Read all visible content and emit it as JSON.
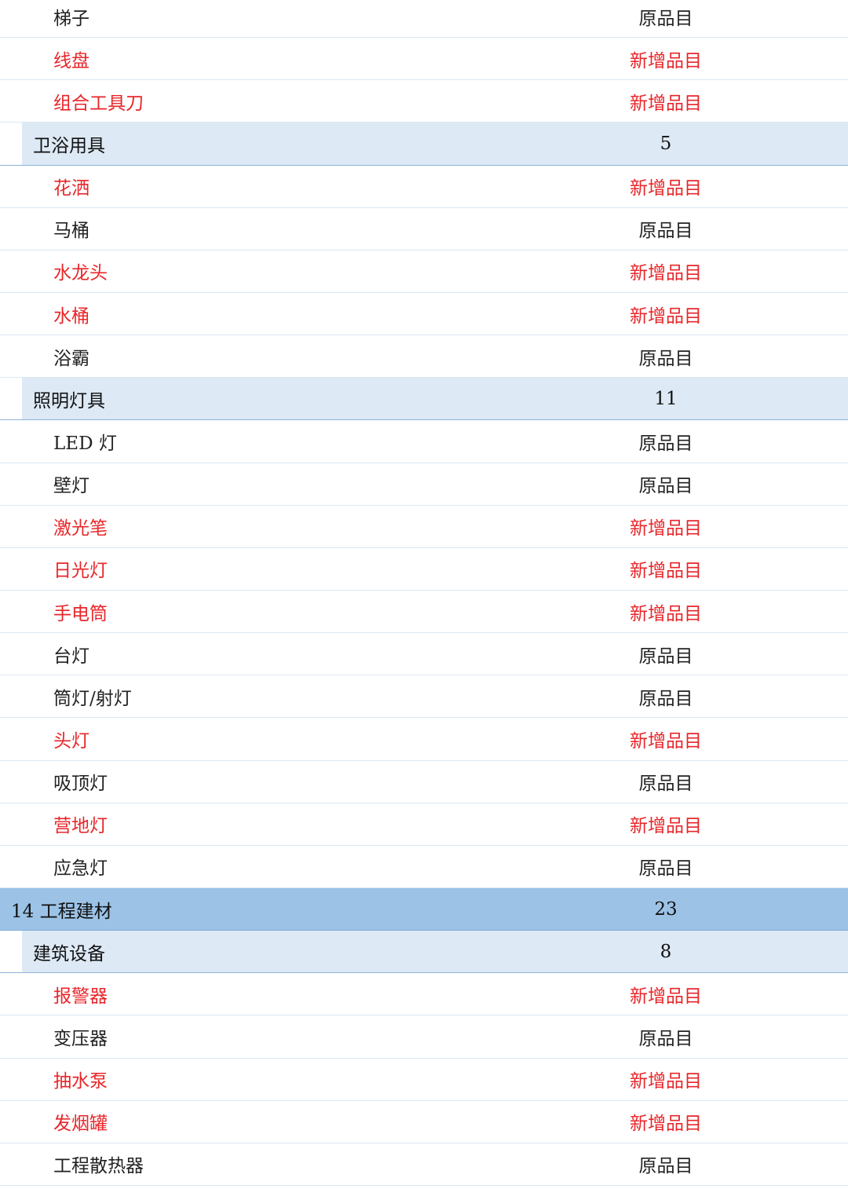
{
  "rows": [
    {
      "type": "item",
      "name": "梯子",
      "value": "原品目",
      "new": false
    },
    {
      "type": "item",
      "name": "线盘",
      "value": "新增品目",
      "new": true
    },
    {
      "type": "item",
      "name": "组合工具刀",
      "value": "新增品目",
      "new": true
    },
    {
      "type": "sub",
      "name": "卫浴用具",
      "value": "5"
    },
    {
      "type": "item",
      "name": "花洒",
      "value": "新增品目",
      "new": true
    },
    {
      "type": "item",
      "name": "马桶",
      "value": "原品目",
      "new": false
    },
    {
      "type": "item",
      "name": "水龙头",
      "value": "新增品目",
      "new": true
    },
    {
      "type": "item",
      "name": "水桶",
      "value": "新增品目",
      "new": true
    },
    {
      "type": "item",
      "name": "浴霸",
      "value": "原品目",
      "new": false
    },
    {
      "type": "sub",
      "name": "照明灯具",
      "value": "11"
    },
    {
      "type": "item",
      "name": "LED 灯",
      "value": "原品目",
      "new": false
    },
    {
      "type": "item",
      "name": "壁灯",
      "value": "原品目",
      "new": false
    },
    {
      "type": "item",
      "name": "激光笔",
      "value": "新增品目",
      "new": true
    },
    {
      "type": "item",
      "name": "日光灯",
      "value": "新增品目",
      "new": true
    },
    {
      "type": "item",
      "name": "手电筒",
      "value": "新增品目",
      "new": true
    },
    {
      "type": "item",
      "name": "台灯",
      "value": "原品目",
      "new": false
    },
    {
      "type": "item",
      "name": "筒灯/射灯",
      "value": "原品目",
      "new": false
    },
    {
      "type": "item",
      "name": "头灯",
      "value": "新增品目",
      "new": true
    },
    {
      "type": "item",
      "name": "吸顶灯",
      "value": "原品目",
      "new": false
    },
    {
      "type": "item",
      "name": "营地灯",
      "value": "新增品目",
      "new": true
    },
    {
      "type": "item",
      "name": "应急灯",
      "value": "原品目",
      "new": false
    },
    {
      "type": "cat",
      "name": "14 工程建材",
      "value": "23"
    },
    {
      "type": "sub",
      "name": "建筑设备",
      "value": "8"
    },
    {
      "type": "item",
      "name": "报警器",
      "value": "新增品目",
      "new": true
    },
    {
      "type": "item",
      "name": "变压器",
      "value": "原品目",
      "new": false
    },
    {
      "type": "item",
      "name": "抽水泵",
      "value": "新增品目",
      "new": true
    },
    {
      "type": "item",
      "name": "发烟罐",
      "value": "新增品目",
      "new": true
    },
    {
      "type": "item",
      "name": "工程散热器",
      "value": "原品目",
      "new": false
    }
  ],
  "colors": {
    "new_item_text": "#e8262a",
    "original_item_text": "#222222",
    "subcategory_bg": "#dde9f5",
    "category_bg": "#9cc3e6"
  }
}
